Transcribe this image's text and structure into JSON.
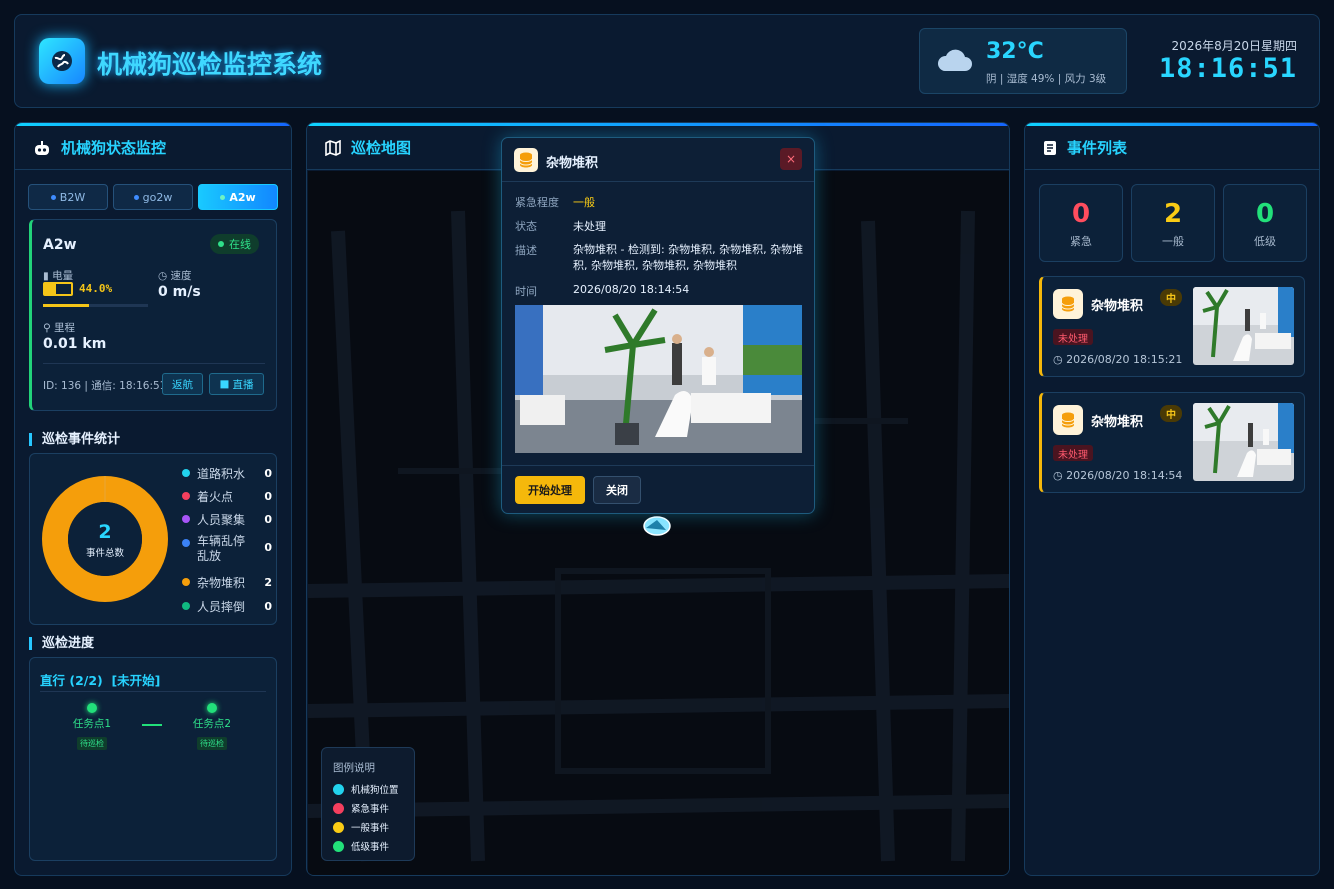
{
  "header": {
    "title": "机械狗巡检监控系统",
    "temperature": "32°C",
    "weather_desc": "阴 | 湿度 49% | 风力 3级",
    "date": "2026年8月20日星期四",
    "time": "18:16:51"
  },
  "left": {
    "title": "机械狗状态监控",
    "tabs": [
      {
        "label": "B2W"
      },
      {
        "label": "go2w"
      },
      {
        "label": "A2w"
      }
    ],
    "active_tab": "A2w",
    "dog": {
      "name": "A2w",
      "status": "在线",
      "battery_label": "电量",
      "battery_value": "44.0%",
      "battery_level": 0.44,
      "speed_label": "速度",
      "speed_value": "0 m/s",
      "mileage_label": "里程",
      "mileage_value": "0.01 km",
      "meta": "ID: 136 | 通信: 18:16:51",
      "return_btn": "返航",
      "live_btn": "直播"
    },
    "stats_title": "巡检事件统计",
    "donut": {
      "total": "2",
      "label": "事件总数"
    },
    "event_types": [
      {
        "name": "道路积水",
        "count": "0",
        "color": "#22d3ee"
      },
      {
        "name": "着火点",
        "count": "0",
        "color": "#f43f5e"
      },
      {
        "name": "人员聚集",
        "count": "0",
        "color": "#a855f7"
      },
      {
        "name": "车辆乱停乱放",
        "count": "0",
        "color": "#3b82f6"
      },
      {
        "name": "杂物堆积",
        "count": "2",
        "color": "#f59e0b"
      },
      {
        "name": "人员摔倒",
        "count": "0",
        "color": "#10b981"
      }
    ],
    "progress_title": "巡检进度",
    "progress": {
      "route": "直行 (2/2)",
      "state": "[未开始]",
      "points": [
        {
          "name": "任务点1",
          "status": "待巡检"
        },
        {
          "name": "任务点2",
          "status": "待巡检"
        }
      ]
    }
  },
  "map": {
    "title": "巡检地图",
    "popup": {
      "title": "杂物堆积",
      "close": "×",
      "urgency_label": "紧急程度",
      "urgency_value": "一般",
      "status_label": "状态",
      "status_value": "未处理",
      "desc_label": "描述",
      "desc_value": "杂物堆积 - 检测到: 杂物堆积, 杂物堆积, 杂物堆积, 杂物堆积, 杂物堆积, 杂物堆积",
      "time_label": "时间",
      "time_value": "2026/08/20 18:14:54",
      "start_btn": "开始处理",
      "close_btn": "关闭"
    },
    "legend": {
      "title": "图例说明",
      "items": [
        {
          "label": "机械狗位置",
          "color": "#22d3ee"
        },
        {
          "label": "紧急事件",
          "color": "#f43f5e"
        },
        {
          "label": "一般事件",
          "color": "#facc15"
        },
        {
          "label": "低级事件",
          "color": "#22e07a"
        }
      ]
    }
  },
  "right": {
    "title": "事件列表",
    "stats": [
      {
        "value": "0",
        "label": "紧急",
        "color": "#ff4d5e"
      },
      {
        "value": "2",
        "label": "一般",
        "color": "#facc15"
      },
      {
        "value": "0",
        "label": "低级",
        "color": "#22e07a"
      }
    ],
    "events": [
      {
        "title": "杂物堆积",
        "level": "中",
        "status": "未处理",
        "time": "2026/08/20 18:15:21"
      },
      {
        "title": "杂物堆积",
        "level": "中",
        "status": "未处理",
        "time": "2026/08/20 18:14:54"
      }
    ]
  }
}
